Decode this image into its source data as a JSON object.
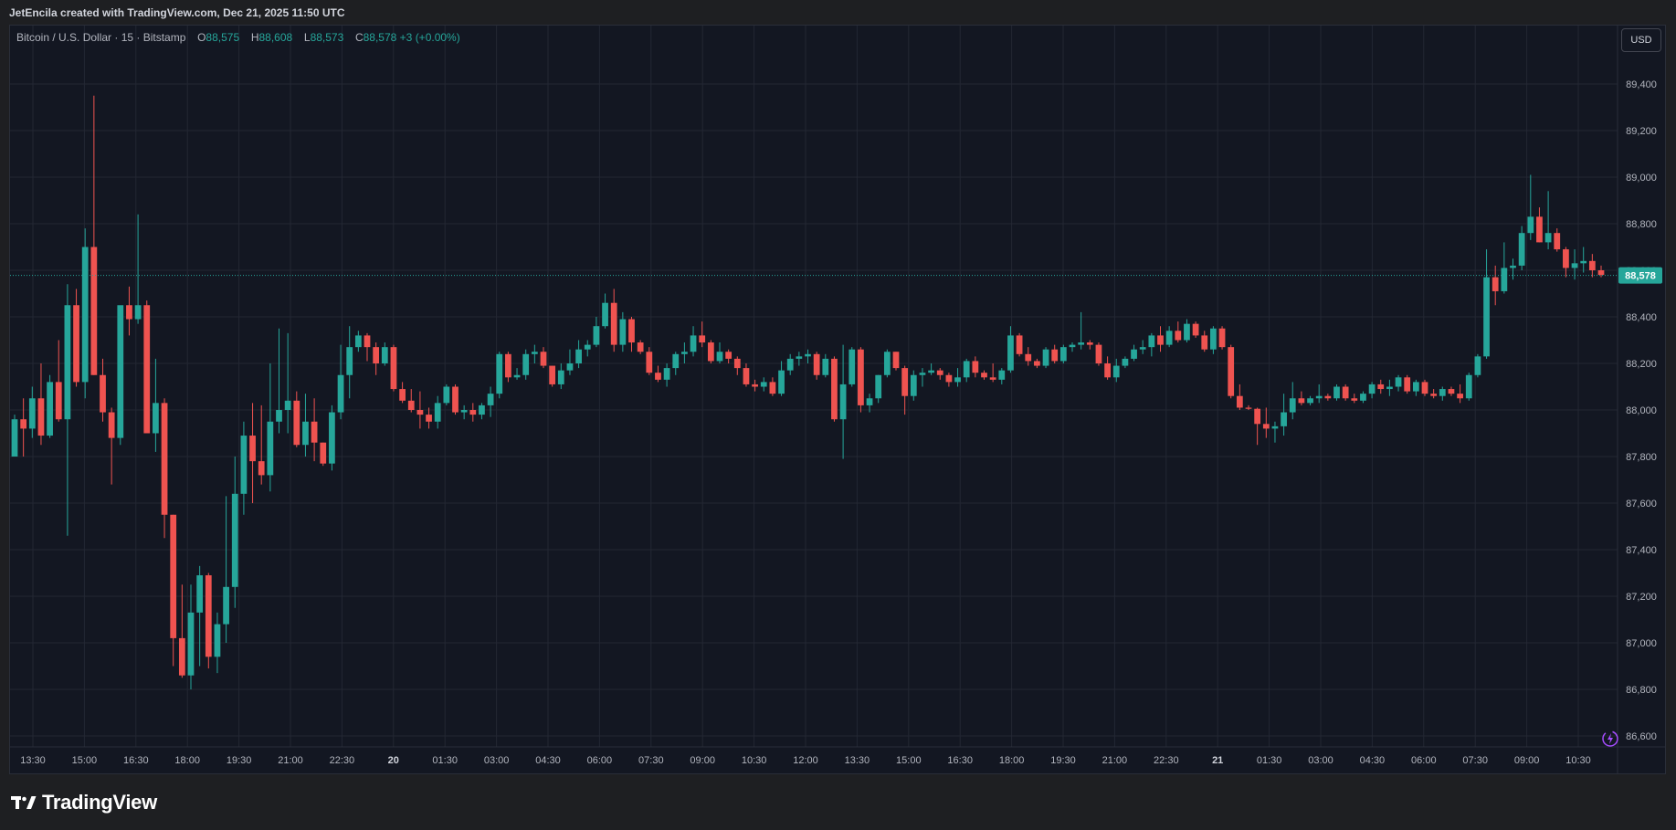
{
  "attribution": "JetEncila created with TradingView.com, Dec 21, 2025 11:50 UTC",
  "legend": {
    "symbol": "Bitcoin / U.S. Dollar · 15 · Bitstamp",
    "o_label": "O",
    "o_value": "88,575",
    "h_label": "H",
    "h_value": "88,608",
    "l_label": "L",
    "l_value": "88,573",
    "c_label": "C",
    "c_value": "88,578",
    "change": "+3 (+0.00%)"
  },
  "currency_button": "USD",
  "brand": "TradingView",
  "colors": {
    "up": "#26a69a",
    "down": "#ef5350",
    "background": "#131722",
    "grid": "#232733",
    "text": "#b2b5be"
  },
  "chart_data": {
    "type": "candlestick",
    "ylim": [
      86550,
      89600
    ],
    "y_ticks": [
      86600,
      86800,
      87000,
      87200,
      87400,
      87600,
      87800,
      88000,
      88200,
      88400,
      88600,
      88800,
      89000,
      89200,
      89400
    ],
    "y_tick_labels": [
      "86,600",
      "86,800",
      "87,000",
      "87,200",
      "87,400",
      "87,600",
      "87,800",
      "88,000",
      "88,200",
      "88,400",
      "88,600",
      "88,800",
      "89,000",
      "89,200",
      "89,400"
    ],
    "x_ticks": [
      "13:30",
      "15:00",
      "16:30",
      "18:00",
      "19:30",
      "21:00",
      "22:30",
      "20",
      "01:30",
      "03:00",
      "04:30",
      "06:00",
      "07:30",
      "09:00",
      "10:30",
      "12:00",
      "13:30",
      "15:00",
      "16:30",
      "18:00",
      "19:30",
      "21:00",
      "22:30",
      "21",
      "01:30",
      "03:00",
      "04:30",
      "06:00",
      "07:30",
      "09:00",
      "10:30"
    ],
    "x_tick_bold": [
      false,
      false,
      false,
      false,
      false,
      false,
      false,
      true,
      false,
      false,
      false,
      false,
      false,
      false,
      false,
      false,
      false,
      false,
      false,
      false,
      false,
      false,
      false,
      true,
      false,
      false,
      false,
      false,
      false,
      false,
      false
    ],
    "last_price": 88578,
    "last_price_label": "88,578",
    "candles": [
      [
        87800,
        87980,
        87800,
        87960
      ],
      [
        87960,
        88050,
        87800,
        87920
      ],
      [
        87920,
        88100,
        87880,
        88050
      ],
      [
        88050,
        88200,
        87850,
        87890
      ],
      [
        87890,
        88150,
        87880,
        88120
      ],
      [
        88120,
        88300,
        87950,
        87960
      ],
      [
        87960,
        88540,
        87460,
        88450
      ],
      [
        88450,
        88520,
        88100,
        88120
      ],
      [
        88120,
        88780,
        88050,
        88700
      ],
      [
        88700,
        89350,
        88150,
        88150
      ],
      [
        88150,
        88220,
        87950,
        87990
      ],
      [
        87990,
        88010,
        87680,
        87880
      ],
      [
        87880,
        88420,
        87850,
        88450
      ],
      [
        88450,
        88530,
        88320,
        88390
      ],
      [
        88390,
        88840,
        88370,
        88450
      ],
      [
        88450,
        88470,
        87950,
        87900
      ],
      [
        87900,
        88220,
        87820,
        88030
      ],
      [
        88030,
        88050,
        87450,
        87550
      ],
      [
        87550,
        87550,
        86900,
        87020
      ],
      [
        87020,
        87250,
        86850,
        86860
      ],
      [
        86860,
        87250,
        86800,
        87130
      ],
      [
        87130,
        87330,
        86900,
        87290
      ],
      [
        87290,
        87300,
        86890,
        86940
      ],
      [
        86940,
        87130,
        86870,
        87080
      ],
      [
        87080,
        87630,
        87000,
        87240
      ],
      [
        87240,
        87800,
        87150,
        87640
      ],
      [
        87640,
        87950,
        87550,
        87890
      ],
      [
        87890,
        88030,
        87600,
        87780
      ],
      [
        87780,
        88020,
        87680,
        87720
      ],
      [
        87720,
        88200,
        87650,
        87950
      ],
      [
        87950,
        88350,
        87900,
        88000
      ],
      [
        88000,
        88330,
        87900,
        88040
      ],
      [
        88040,
        88080,
        87840,
        87850
      ],
      [
        87850,
        88070,
        87800,
        87950
      ],
      [
        87950,
        88050,
        87780,
        87860
      ],
      [
        87860,
        87860,
        87760,
        87770
      ],
      [
        87770,
        88020,
        87740,
        87990
      ],
      [
        87990,
        88280,
        87960,
        88150
      ],
      [
        88150,
        88360,
        88050,
        88270
      ],
      [
        88270,
        88340,
        88250,
        88320
      ],
      [
        88320,
        88330,
        88210,
        88270
      ],
      [
        88270,
        88290,
        88150,
        88200
      ],
      [
        88200,
        88290,
        88190,
        88270
      ],
      [
        88270,
        88280,
        88080,
        88090
      ],
      [
        88090,
        88120,
        88030,
        88040
      ],
      [
        88040,
        88090,
        87990,
        88000
      ],
      [
        88000,
        88080,
        87920,
        87980
      ],
      [
        87980,
        88010,
        87920,
        87950
      ],
      [
        87950,
        88060,
        87920,
        88030
      ],
      [
        88030,
        88110,
        88020,
        88100
      ],
      [
        88100,
        88110,
        87980,
        87990
      ],
      [
        87990,
        88020,
        87960,
        88000
      ],
      [
        88000,
        88030,
        87950,
        87980
      ],
      [
        87980,
        88030,
        87960,
        88020
      ],
      [
        88020,
        88100,
        87970,
        88070
      ],
      [
        88070,
        88250,
        88050,
        88240
      ],
      [
        88240,
        88250,
        88120,
        88140
      ],
      [
        88140,
        88180,
        88130,
        88150
      ],
      [
        88150,
        88260,
        88130,
        88240
      ],
      [
        88240,
        88280,
        88200,
        88250
      ],
      [
        88250,
        88270,
        88180,
        88190
      ],
      [
        88190,
        88190,
        88100,
        88110
      ],
      [
        88110,
        88200,
        88090,
        88170
      ],
      [
        88170,
        88260,
        88150,
        88200
      ],
      [
        88200,
        88300,
        88180,
        88260
      ],
      [
        88260,
        88300,
        88230,
        88280
      ],
      [
        88280,
        88400,
        88270,
        88360
      ],
      [
        88360,
        88500,
        88350,
        88460
      ],
      [
        88460,
        88520,
        88250,
        88280
      ],
      [
        88280,
        88420,
        88250,
        88390
      ],
      [
        88390,
        88400,
        88250,
        88290
      ],
      [
        88290,
        88300,
        88240,
        88250
      ],
      [
        88250,
        88270,
        88150,
        88160
      ],
      [
        88160,
        88190,
        88120,
        88130
      ],
      [
        88130,
        88200,
        88100,
        88180
      ],
      [
        88180,
        88250,
        88150,
        88240
      ],
      [
        88240,
        88290,
        88200,
        88250
      ],
      [
        88250,
        88360,
        88230,
        88320
      ],
      [
        88320,
        88380,
        88270,
        88290
      ],
      [
        88290,
        88300,
        88200,
        88210
      ],
      [
        88210,
        88290,
        88200,
        88250
      ],
      [
        88250,
        88260,
        88200,
        88220
      ],
      [
        88220,
        88230,
        88150,
        88180
      ],
      [
        88180,
        88200,
        88100,
        88110
      ],
      [
        88110,
        88130,
        88080,
        88100
      ],
      [
        88100,
        88140,
        88080,
        88120
      ],
      [
        88120,
        88140,
        88060,
        88070
      ],
      [
        88070,
        88210,
        88060,
        88170
      ],
      [
        88170,
        88240,
        88150,
        88220
      ],
      [
        88220,
        88250,
        88190,
        88230
      ],
      [
        88230,
        88260,
        88200,
        88240
      ],
      [
        88240,
        88250,
        88130,
        88150
      ],
      [
        88150,
        88240,
        88140,
        88220
      ],
      [
        88220,
        88230,
        87950,
        87960
      ],
      [
        87960,
        88280,
        87790,
        88110
      ],
      [
        88110,
        88270,
        88100,
        88260
      ],
      [
        88260,
        88270,
        87990,
        88020
      ],
      [
        88020,
        88070,
        87990,
        88050
      ],
      [
        88050,
        88150,
        88030,
        88150
      ],
      [
        88150,
        88260,
        88140,
        88250
      ],
      [
        88250,
        88250,
        88170,
        88180
      ],
      [
        88180,
        88190,
        87980,
        88060
      ],
      [
        88060,
        88170,
        88040,
        88150
      ],
      [
        88150,
        88180,
        88100,
        88160
      ],
      [
        88160,
        88200,
        88150,
        88170
      ],
      [
        88170,
        88180,
        88130,
        88150
      ],
      [
        88150,
        88160,
        88100,
        88120
      ],
      [
        88120,
        88180,
        88100,
        88140
      ],
      [
        88140,
        88220,
        88120,
        88210
      ],
      [
        88210,
        88230,
        88140,
        88160
      ],
      [
        88160,
        88170,
        88130,
        88140
      ],
      [
        88140,
        88200,
        88120,
        88130
      ],
      [
        88130,
        88180,
        88110,
        88170
      ],
      [
        88170,
        88360,
        88160,
        88320
      ],
      [
        88320,
        88330,
        88230,
        88240
      ],
      [
        88240,
        88270,
        88190,
        88210
      ],
      [
        88210,
        88220,
        88180,
        88190
      ],
      [
        88190,
        88270,
        88180,
        88260
      ],
      [
        88260,
        88280,
        88200,
        88210
      ],
      [
        88210,
        88280,
        88200,
        88270
      ],
      [
        88270,
        88290,
        88250,
        88280
      ],
      [
        88280,
        88420,
        88260,
        88290
      ],
      [
        88290,
        88300,
        88260,
        88280
      ],
      [
        88280,
        88290,
        88190,
        88200
      ],
      [
        88200,
        88230,
        88130,
        88140
      ],
      [
        88140,
        88220,
        88120,
        88190
      ],
      [
        88190,
        88230,
        88180,
        88220
      ],
      [
        88220,
        88280,
        88210,
        88260
      ],
      [
        88260,
        88300,
        88240,
        88270
      ],
      [
        88270,
        88330,
        88230,
        88320
      ],
      [
        88320,
        88360,
        88250,
        88280
      ],
      [
        88280,
        88360,
        88270,
        88340
      ],
      [
        88340,
        88380,
        88290,
        88300
      ],
      [
        88300,
        88390,
        88290,
        88370
      ],
      [
        88370,
        88380,
        88310,
        88320
      ],
      [
        88320,
        88340,
        88250,
        88260
      ],
      [
        88260,
        88360,
        88240,
        88350
      ],
      [
        88350,
        88360,
        88260,
        88270
      ],
      [
        88270,
        88280,
        88050,
        88060
      ],
      [
        88060,
        88110,
        88000,
        88010
      ],
      [
        88010,
        88020,
        88000,
        88005
      ],
      [
        88005,
        88010,
        87850,
        87940
      ],
      [
        87940,
        88010,
        87880,
        87920
      ],
      [
        87920,
        87950,
        87860,
        87930
      ],
      [
        87930,
        88070,
        87890,
        87990
      ],
      [
        87990,
        88120,
        87960,
        88050
      ],
      [
        88050,
        88080,
        88020,
        88030
      ],
      [
        88030,
        88060,
        88020,
        88050
      ],
      [
        88050,
        88110,
        88030,
        88060
      ],
      [
        88060,
        88070,
        88040,
        88050
      ],
      [
        88050,
        88110,
        88040,
        88100
      ],
      [
        88100,
        88110,
        88040,
        88050
      ],
      [
        88050,
        88070,
        88030,
        88040
      ],
      [
        88040,
        88080,
        88030,
        88070
      ],
      [
        88070,
        88120,
        88050,
        88110
      ],
      [
        88110,
        88130,
        88070,
        88090
      ],
      [
        88090,
        88130,
        88060,
        88100
      ],
      [
        88100,
        88150,
        88080,
        88140
      ],
      [
        88140,
        88150,
        88070,
        88080
      ],
      [
        88080,
        88130,
        88060,
        88120
      ],
      [
        88120,
        88130,
        88060,
        88070
      ],
      [
        88070,
        88090,
        88050,
        88060
      ],
      [
        88060,
        88100,
        88040,
        88090
      ],
      [
        88090,
        88100,
        88060,
        88070
      ],
      [
        88070,
        88110,
        88030,
        88050
      ],
      [
        88050,
        88160,
        88040,
        88150
      ],
      [
        88150,
        88240,
        88140,
        88230
      ],
      [
        88230,
        88690,
        88220,
        88570
      ],
      [
        88570,
        88620,
        88450,
        88510
      ],
      [
        88510,
        88720,
        88500,
        88610
      ],
      [
        88610,
        88650,
        88560,
        88620
      ],
      [
        88620,
        88790,
        88600,
        88760
      ],
      [
        88760,
        89010,
        88730,
        88830
      ],
      [
        88830,
        88870,
        88720,
        88720
      ],
      [
        88720,
        88940,
        88690,
        88760
      ],
      [
        88760,
        88780,
        88680,
        88690
      ],
      [
        88690,
        88700,
        88570,
        88610
      ],
      [
        88610,
        88690,
        88560,
        88630
      ],
      [
        88630,
        88700,
        88590,
        88640
      ],
      [
        88640,
        88670,
        88570,
        88600
      ],
      [
        88600,
        88620,
        88570,
        88580
      ]
    ]
  }
}
